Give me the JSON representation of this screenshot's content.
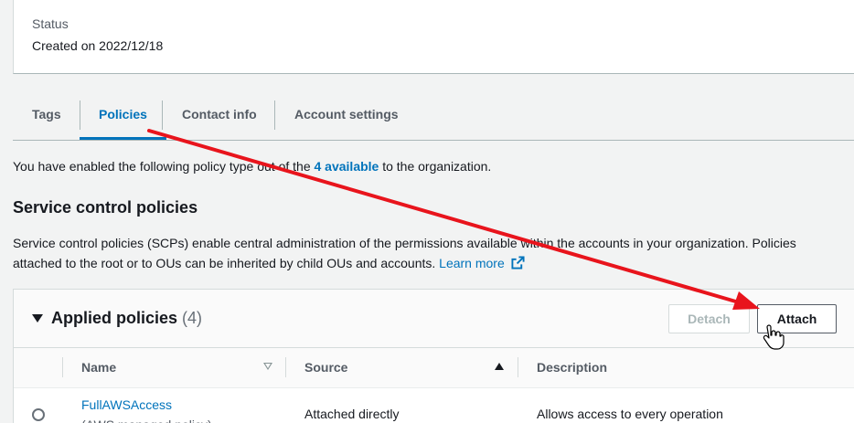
{
  "status": {
    "label": "Status",
    "value": "Created on 2022/12/18"
  },
  "tabs": [
    {
      "label": "Tags"
    },
    {
      "label": "Policies"
    },
    {
      "label": "Contact info"
    },
    {
      "label": "Account settings"
    }
  ],
  "info": {
    "prefix": "You have enabled the following policy type out of the ",
    "link": "4 available",
    "suffix": " to the organization."
  },
  "section": {
    "title": "Service control policies",
    "description": "Service control policies (SCPs) enable central administration of the permissions available within the accounts in your organization. Policies attached to the root or to OUs can be inherited by child OUs and accounts.",
    "learn_more": "Learn more"
  },
  "panel": {
    "title": "Applied policies",
    "count": "(4)",
    "detach_label": "Detach",
    "attach_label": "Attach"
  },
  "table": {
    "columns": {
      "name": "Name",
      "source": "Source",
      "description": "Description"
    },
    "rows": [
      {
        "name": "FullAWSAccess",
        "type": "(AWS managed policy)",
        "source": "Attached directly",
        "description": "Allows access to every operation"
      }
    ]
  },
  "colors": {
    "accent": "#0073bb",
    "arrow": "#e8141c"
  },
  "icons": {
    "external": "external-link-icon",
    "caret": "caret-down-icon",
    "cursor": "hand-cursor-icon"
  }
}
